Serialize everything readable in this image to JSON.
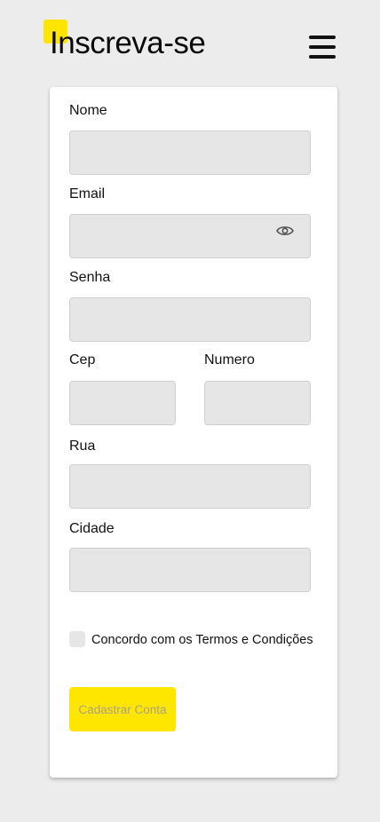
{
  "header": {
    "title": "Inscreva-se",
    "menu_icon": "hamburger-menu-icon",
    "accent_color": "#ffe600"
  },
  "form": {
    "nome": {
      "label": "Nome",
      "value": ""
    },
    "email": {
      "label": "Email",
      "value": "",
      "icon": "eye-icon"
    },
    "senha": {
      "label": "Senha",
      "value": ""
    },
    "cep": {
      "label": "Cep",
      "value": ""
    },
    "numero": {
      "label": "Numero",
      "value": ""
    },
    "rua": {
      "label": "Rua",
      "value": ""
    },
    "cidade": {
      "label": "Cidade",
      "value": ""
    },
    "terms": {
      "label": "Concordo com os Termos e Condições",
      "checked": false
    },
    "submit_label": "Cadastrar Conta"
  }
}
